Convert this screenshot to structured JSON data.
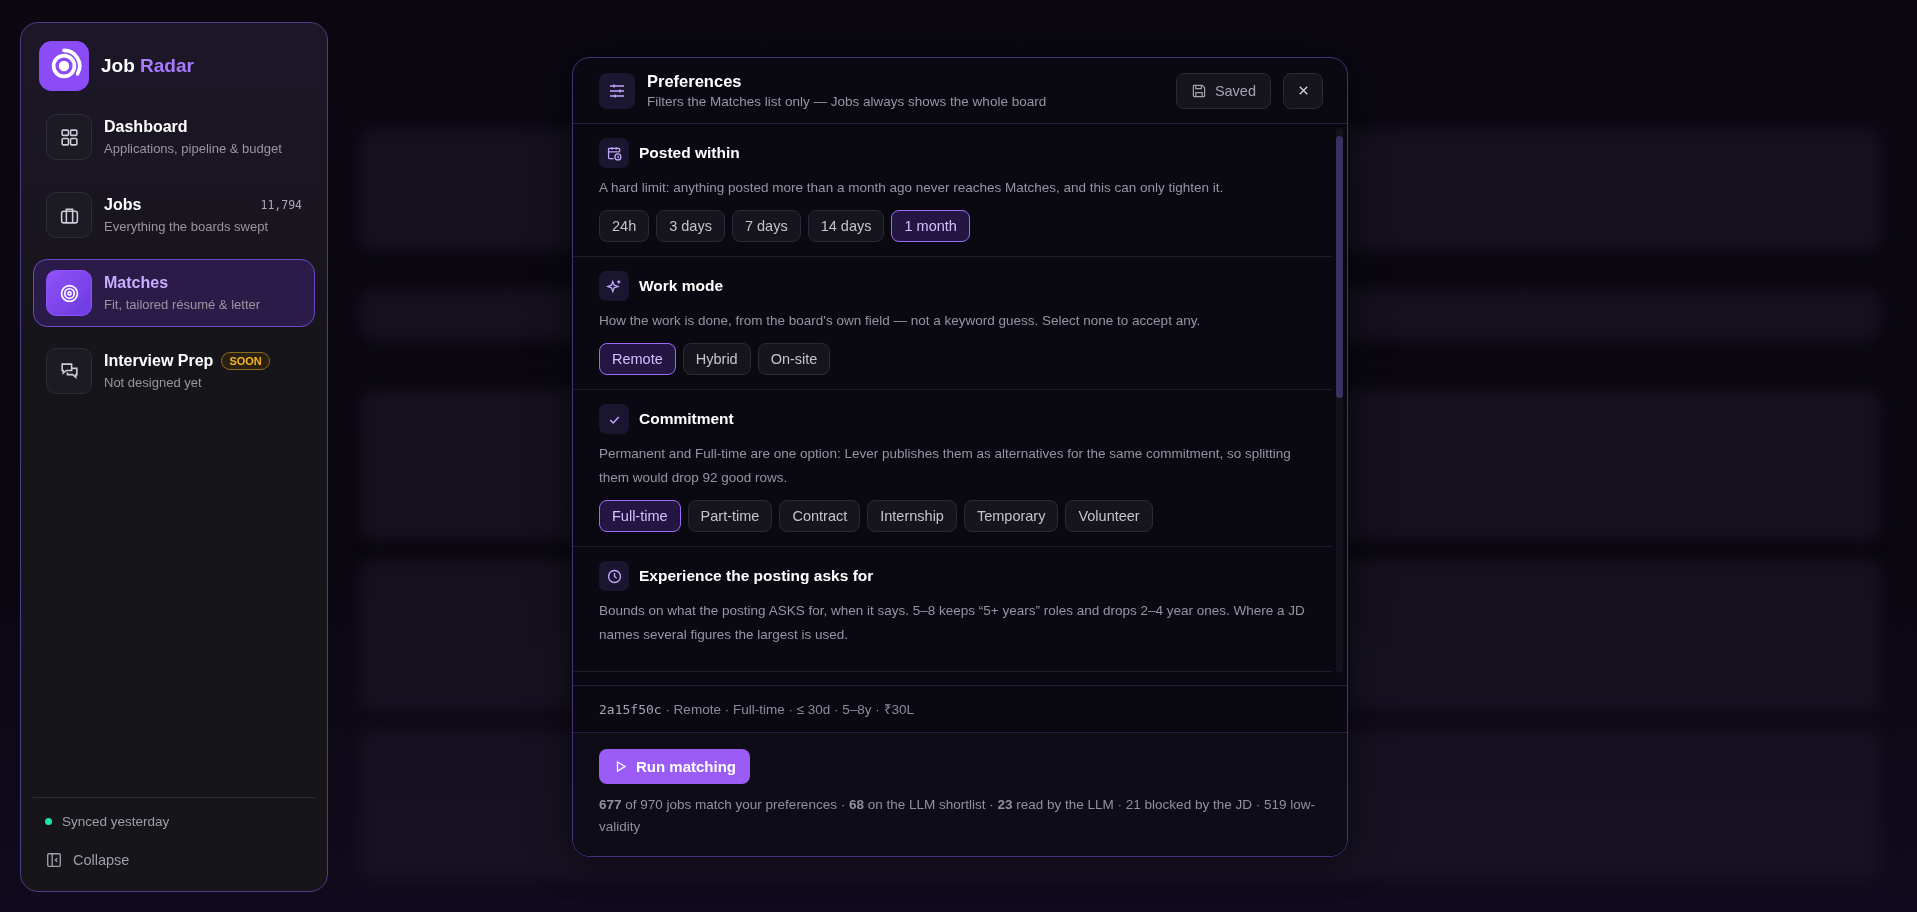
{
  "sidebar": {
    "brand": {
      "first": "Job",
      "second": "Radar"
    },
    "nav": [
      {
        "kind": "grid",
        "title": "Dashboard",
        "subtitle": "Applications, pipeline & budget",
        "selected": false
      },
      {
        "kind": "briefcase",
        "title": "Jobs",
        "subtitle": "Everything the boards swept",
        "count": "11,794",
        "selected": false
      },
      {
        "kind": "target",
        "title": "Matches",
        "subtitle": "Fit, tailored résumé & letter",
        "selected": true
      },
      {
        "kind": "chat",
        "title": "Interview Prep",
        "subtitle": "Not designed yet",
        "badge": "SOON",
        "selected": false
      }
    ],
    "sync": {
      "label": "Synced yesterday",
      "color": "#1ee8a0"
    },
    "collapse": "Collapse"
  },
  "dialog": {
    "title": "Preferences",
    "subtitle": "Filters the Matches list only — Jobs always shows the whole board",
    "saved": "Saved",
    "sections": [
      {
        "kind": "calendar",
        "title": "Posted within",
        "description": "A hard limit: anything posted more than a month ago never reaches Matches, and this can only tighten it.",
        "options": [
          {
            "label": "24h",
            "selected": false
          },
          {
            "label": "3 days",
            "selected": false
          },
          {
            "label": "7 days",
            "selected": false
          },
          {
            "label": "14 days",
            "selected": false
          },
          {
            "label": "1 month",
            "selected": true
          }
        ]
      },
      {
        "kind": "sparkle",
        "title": "Work mode",
        "description": "How the work is done, from the board's own field — not a keyword guess. Select none to accept any.",
        "options": [
          {
            "label": "Remote",
            "selected": true
          },
          {
            "label": "Hybrid",
            "selected": false
          },
          {
            "label": "On-site",
            "selected": false
          }
        ]
      },
      {
        "kind": "check",
        "title": "Commitment",
        "description": "Permanent and Full-time are one option: Lever publishes them as alternatives for the same commitment, so splitting them would drop 92 good rows.",
        "options": [
          {
            "label": "Full-time",
            "selected": true
          },
          {
            "label": "Part-time",
            "selected": false
          },
          {
            "label": "Contract",
            "selected": false
          },
          {
            "label": "Internship",
            "selected": false
          },
          {
            "label": "Temporary",
            "selected": false
          },
          {
            "label": "Volunteer",
            "selected": false
          }
        ]
      },
      {
        "kind": "clock",
        "title": "Experience the posting asks for",
        "description": "Bounds on what the posting ASKS for, when it says. 5–8 keeps “5+ years” roles and drops 2–4 year ones. Where a JD names several figures the largest is used."
      }
    ],
    "summary": {
      "hash": "2a15f50c",
      "text": " · Remote · Full-time · ≤ 30d · 5–8y · ₹30L"
    },
    "run_button": "Run matching",
    "stats": "**677** of 970 jobs match your preferences · **68** on the LLM shortlist · **23** read by the LLM · 21 blocked by the JD · 519 low-validity"
  }
}
